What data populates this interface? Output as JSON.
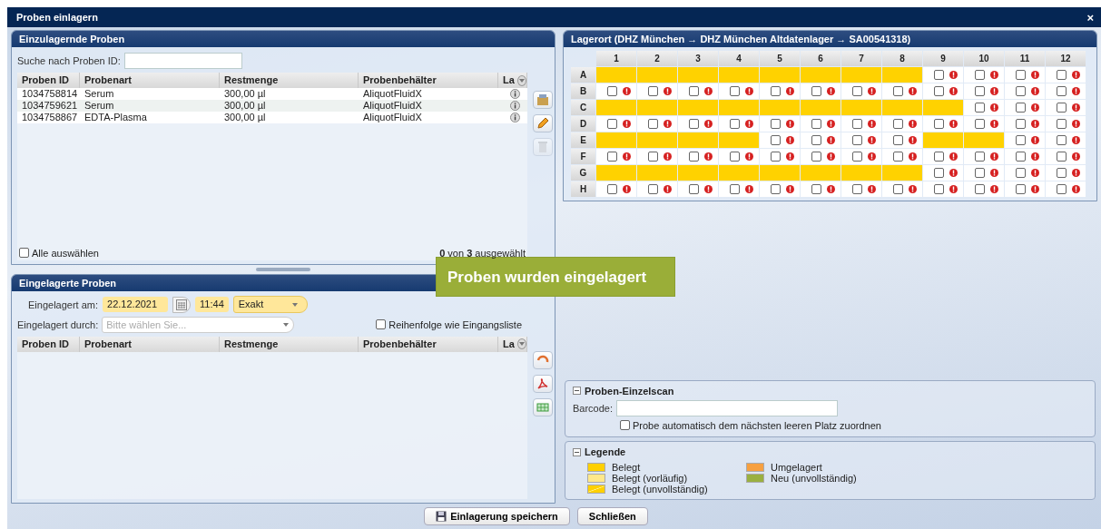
{
  "window": {
    "title": "Proben einlagern",
    "close": "×"
  },
  "pending": {
    "title": "Einzulagernde Proben",
    "search_label": "Suche nach Proben ID:",
    "columns": [
      "Proben ID",
      "Probenart",
      "Restmenge",
      "Probenbehälter",
      "La"
    ],
    "rows": [
      {
        "id": "1034758814",
        "type": "Serum",
        "amount": "300,00 µl",
        "container": "AliquotFluidX"
      },
      {
        "id": "1034759621",
        "type": "Serum",
        "amount": "300,00 µl",
        "container": "AliquotFluidX"
      },
      {
        "id": "1034758867",
        "type": "EDTA-Plasma",
        "amount": "300,00 µl",
        "container": "AliquotFluidX"
      }
    ],
    "select_all": {
      "label": "Alle auswählen",
      "checked": false
    },
    "selection_count": "**0** von **3** ausgewählt"
  },
  "stored": {
    "title": "Eingelagerte Proben",
    "date_label": "Eingelagert am:",
    "date": "22.12.2021",
    "time": "11:44",
    "mode": "Exakt",
    "by_label": "Eingelagert durch:",
    "by_placeholder": "Bitte wählen Sie...",
    "order": {
      "label": "Reihenfolge wie Eingangsliste",
      "checked": false
    },
    "columns": [
      "Proben ID",
      "Probenart",
      "Restmenge",
      "Probenbehälter",
      "La"
    ]
  },
  "grid": {
    "title": "Lagerort (DHZ München  → DHZ München Altdatenlager  → SA00541318)",
    "columns": [
      "1",
      "2",
      "3",
      "4",
      "5",
      "6",
      "7",
      "8",
      "9",
      "10",
      "11",
      "12"
    ],
    "rows": [
      {
        "label": "A",
        "occupied": [
          true,
          true,
          true,
          true,
          true,
          true,
          true,
          true,
          false,
          false,
          false,
          false
        ]
      },
      {
        "label": "B",
        "occupied": [
          false,
          false,
          false,
          false,
          false,
          false,
          false,
          false,
          false,
          false,
          false,
          false
        ]
      },
      {
        "label": "C",
        "occupied": [
          true,
          true,
          true,
          true,
          true,
          true,
          true,
          true,
          true,
          false,
          false,
          false
        ]
      },
      {
        "label": "D",
        "occupied": [
          false,
          false,
          false,
          false,
          false,
          false,
          false,
          false,
          false,
          false,
          false,
          false
        ]
      },
      {
        "label": "E",
        "occupied": [
          true,
          true,
          true,
          true,
          false,
          false,
          false,
          false,
          true,
          true,
          false,
          false
        ]
      },
      {
        "label": "F",
        "occupied": [
          false,
          false,
          false,
          false,
          false,
          false,
          false,
          false,
          false,
          false,
          false,
          false
        ]
      },
      {
        "label": "G",
        "occupied": [
          true,
          true,
          true,
          true,
          true,
          true,
          true,
          true,
          false,
          false,
          false,
          false
        ]
      },
      {
        "label": "H",
        "occupied": [
          false,
          false,
          false,
          false,
          false,
          false,
          false,
          false,
          false,
          false,
          false,
          false
        ]
      }
    ]
  },
  "scan": {
    "title": "Proben-Einzelscan",
    "barcode_label": "Barcode:",
    "auto": {
      "label": "Probe automatisch dem nächsten leeren Platz zuordnen",
      "checked": false
    }
  },
  "legend": {
    "title": "Legende",
    "items": [
      {
        "label": "Belegt",
        "color": "#ffd000",
        "kind": "solid"
      },
      {
        "label": "Belegt (vorläufig)",
        "color": "#ffe88a",
        "kind": "solid"
      },
      {
        "label": "Belegt (unvollständig)",
        "color": "#ffd000",
        "kind": "striped"
      },
      {
        "label": "Umgelagert",
        "color": "#f7a040",
        "kind": "solid"
      },
      {
        "label": "Neu (unvollständig)",
        "color": "#9ab040",
        "kind": "solid"
      }
    ]
  },
  "buttons": {
    "save": "Einlagerung speichern",
    "close": "Schließen"
  },
  "toast": "Proben wurden eingelagert"
}
